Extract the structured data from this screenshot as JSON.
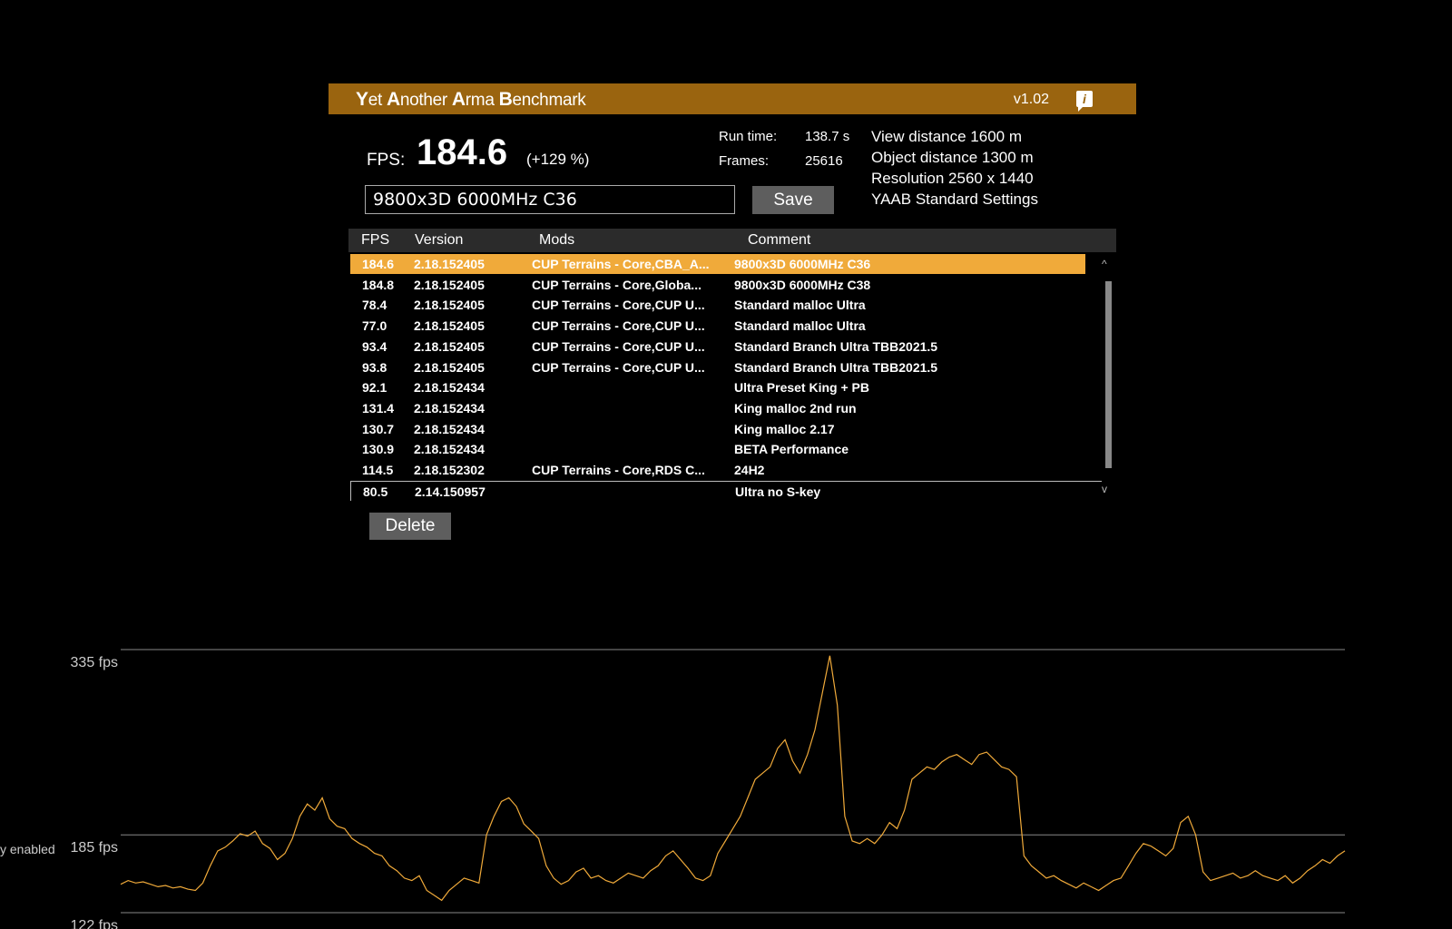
{
  "header": {
    "title_parts": [
      {
        "initial": "Y",
        "rest": "et "
      },
      {
        "initial": "A",
        "rest": "nother "
      },
      {
        "initial": "A",
        "rest": "rma "
      },
      {
        "initial": "B",
        "rest": "enchmark"
      }
    ],
    "version": "v1.02",
    "info_icon": "i"
  },
  "result": {
    "fps_label": "FPS:",
    "fps_value": "184.6",
    "fps_change": "(+129 %)",
    "run_time_label": "Run time:",
    "run_time_value": "138.7 s",
    "frames_label": "Frames:",
    "frames_value": "25616"
  },
  "settings": {
    "view_distance": "View distance 1600 m",
    "object_distance": "Object distance 1300 m",
    "resolution": "Resolution 2560 x 1440",
    "preset": "YAAB Standard Settings"
  },
  "name_input": {
    "value": "9800x3D 6000MHz C36"
  },
  "save_label": "Save",
  "delete_label": "Delete",
  "table": {
    "headers": {
      "fps": "FPS",
      "version": "Version",
      "mods": "Mods",
      "comment": "Comment"
    },
    "rows": [
      {
        "fps": "184.6",
        "version": "2.18.152405",
        "mods": "CUP Terrains - Core,CBA_A...",
        "comment": "9800x3D 6000MHz C36"
      },
      {
        "fps": "184.8",
        "version": "2.18.152405",
        "mods": "CUP Terrains - Core,Globa...",
        "comment": "9800x3D 6000MHz C38"
      },
      {
        "fps": "78.4",
        "version": "2.18.152405",
        "mods": "CUP Terrains - Core,CUP U...",
        "comment": "Standard malloc Ultra"
      },
      {
        "fps": "77.0",
        "version": "2.18.152405",
        "mods": "CUP Terrains - Core,CUP U...",
        "comment": "Standard malloc Ultra"
      },
      {
        "fps": "93.4",
        "version": "2.18.152405",
        "mods": "CUP Terrains - Core,CUP U...",
        "comment": "Standard Branch Ultra TBB2021.5"
      },
      {
        "fps": "93.8",
        "version": "2.18.152405",
        "mods": "CUP Terrains - Core,CUP U...",
        "comment": "Standard Branch Ultra TBB2021.5"
      },
      {
        "fps": "92.1",
        "version": "2.18.152434",
        "mods": "",
        "comment": "Ultra Preset King + PB"
      },
      {
        "fps": "131.4",
        "version": "2.18.152434",
        "mods": "",
        "comment": "King malloc 2nd run"
      },
      {
        "fps": "130.7",
        "version": "2.18.152434",
        "mods": "",
        "comment": "King malloc 2.17"
      },
      {
        "fps": "130.9",
        "version": "2.18.152434",
        "mods": "",
        "comment": "BETA Performance"
      },
      {
        "fps": "114.5",
        "version": "2.18.152302",
        "mods": "CUP Terrains - Core,RDS C...",
        "comment": "24H2"
      },
      {
        "fps": "80.5",
        "version": "2.14.150957",
        "mods": "",
        "comment": "Ultra no S-key"
      }
    ],
    "scroll_up": "^",
    "scroll_down": "v"
  },
  "side_label": "y enabled",
  "chart_data": {
    "type": "line",
    "yticks": [
      "335 fps",
      "185 fps",
      "122 fps"
    ],
    "ytick_values": [
      335,
      185,
      122
    ],
    "line_color": "#f0aa3a",
    "series": [
      {
        "values": [
          145,
          148,
          146,
          147,
          145,
          143,
          144,
          142,
          143,
          141,
          140,
          146,
          160,
          172,
          175,
          180,
          186,
          184,
          188,
          178,
          174,
          165,
          170,
          182,
          200,
          210,
          205,
          215,
          198,
          192,
          190,
          182,
          178,
          175,
          170,
          168,
          160,
          156,
          150,
          148,
          152,
          140,
          136,
          132,
          140,
          145,
          150,
          148,
          146,
          185,
          200,
          212,
          215,
          208,
          194,
          188,
          182,
          160,
          150,
          145,
          148,
          155,
          158,
          150,
          152,
          148,
          146,
          150,
          154,
          152,
          150,
          156,
          160,
          168,
          172,
          165,
          158,
          150,
          148,
          152,
          170,
          180,
          190,
          200,
          215,
          230,
          235,
          240,
          255,
          262,
          245,
          235,
          250,
          270,
          300,
          330,
          290,
          200,
          180,
          178,
          182,
          178,
          185,
          195,
          190,
          205,
          230,
          235,
          240,
          238,
          244,
          248,
          250,
          246,
          242,
          250,
          252,
          246,
          240,
          238,
          232,
          168,
          160,
          155,
          150,
          152,
          148,
          145,
          142,
          146,
          143,
          140,
          144,
          148,
          150,
          160,
          170,
          178,
          176,
          172,
          168,
          174,
          195,
          200,
          185,
          155,
          148,
          150,
          152,
          154,
          150,
          152,
          156,
          152,
          150,
          148,
          152,
          146,
          150,
          156,
          160,
          165,
          162,
          168,
          172
        ],
        "min": 122,
        "max": 335
      }
    ]
  },
  "colors": {
    "header_bg": "#9a640f",
    "selected_row": "#f0aa3a",
    "button_bg": "#5e5e5e",
    "table_header_bg": "#2b2b2b"
  }
}
